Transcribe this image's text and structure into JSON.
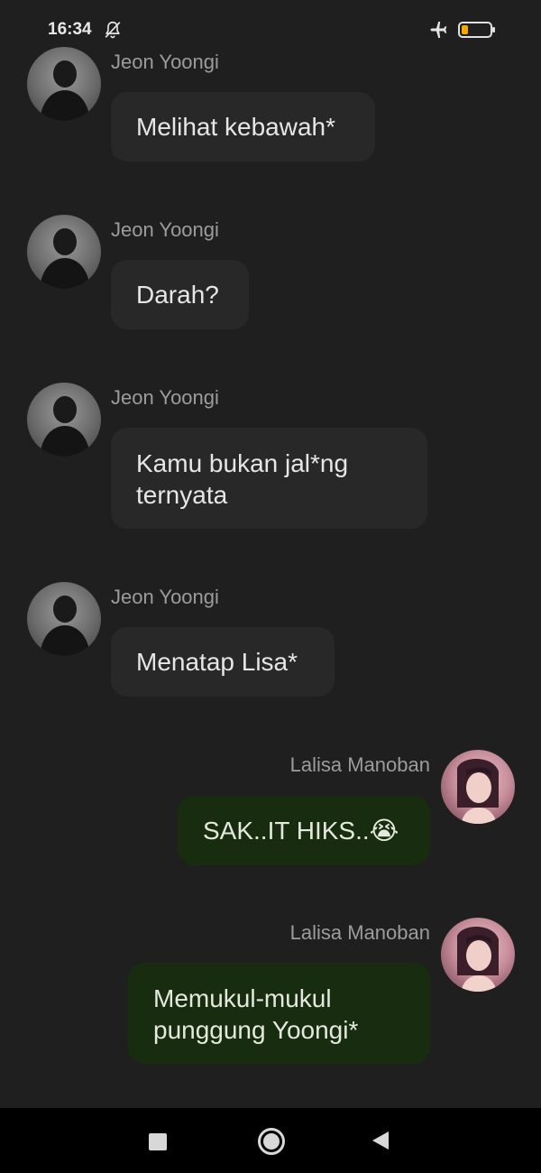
{
  "status_bar": {
    "time": "16:34",
    "battery_level": "22",
    "battery_fraction": 0.22,
    "icons": [
      "bell-off-icon",
      "airplane-icon",
      "battery-icon"
    ]
  },
  "messages": [
    {
      "sender": "Jeon Yoongi",
      "direction": "incoming",
      "lines": [
        "Melihat kebawah*"
      ]
    },
    {
      "sender": "Jeon Yoongi",
      "direction": "incoming",
      "lines": [
        "Darah?"
      ]
    },
    {
      "sender": "Jeon Yoongi",
      "direction": "incoming",
      "lines": [
        "Kamu bukan jal*ng",
        "ternyata"
      ]
    },
    {
      "sender": "Jeon Yoongi",
      "direction": "incoming",
      "lines": [
        "Menatap Lisa*"
      ]
    },
    {
      "sender": "Lalisa Manoban",
      "direction": "outgoing",
      "lines": [
        "SAK..IT HIKS..😭"
      ]
    },
    {
      "sender": "Lalisa Manoban",
      "direction": "outgoing",
      "lines": [
        "Memukul-mukul",
        "punggung Yoongi*"
      ]
    }
  ],
  "colors": {
    "background": "#1f1f1f",
    "incoming_bubble": "#282828",
    "outgoing_bubble": "#182c0f",
    "name_text": "#9c9c9c"
  },
  "nav_bar": {
    "icons": [
      "recent-apps-icon",
      "home-icon",
      "back-icon"
    ]
  }
}
